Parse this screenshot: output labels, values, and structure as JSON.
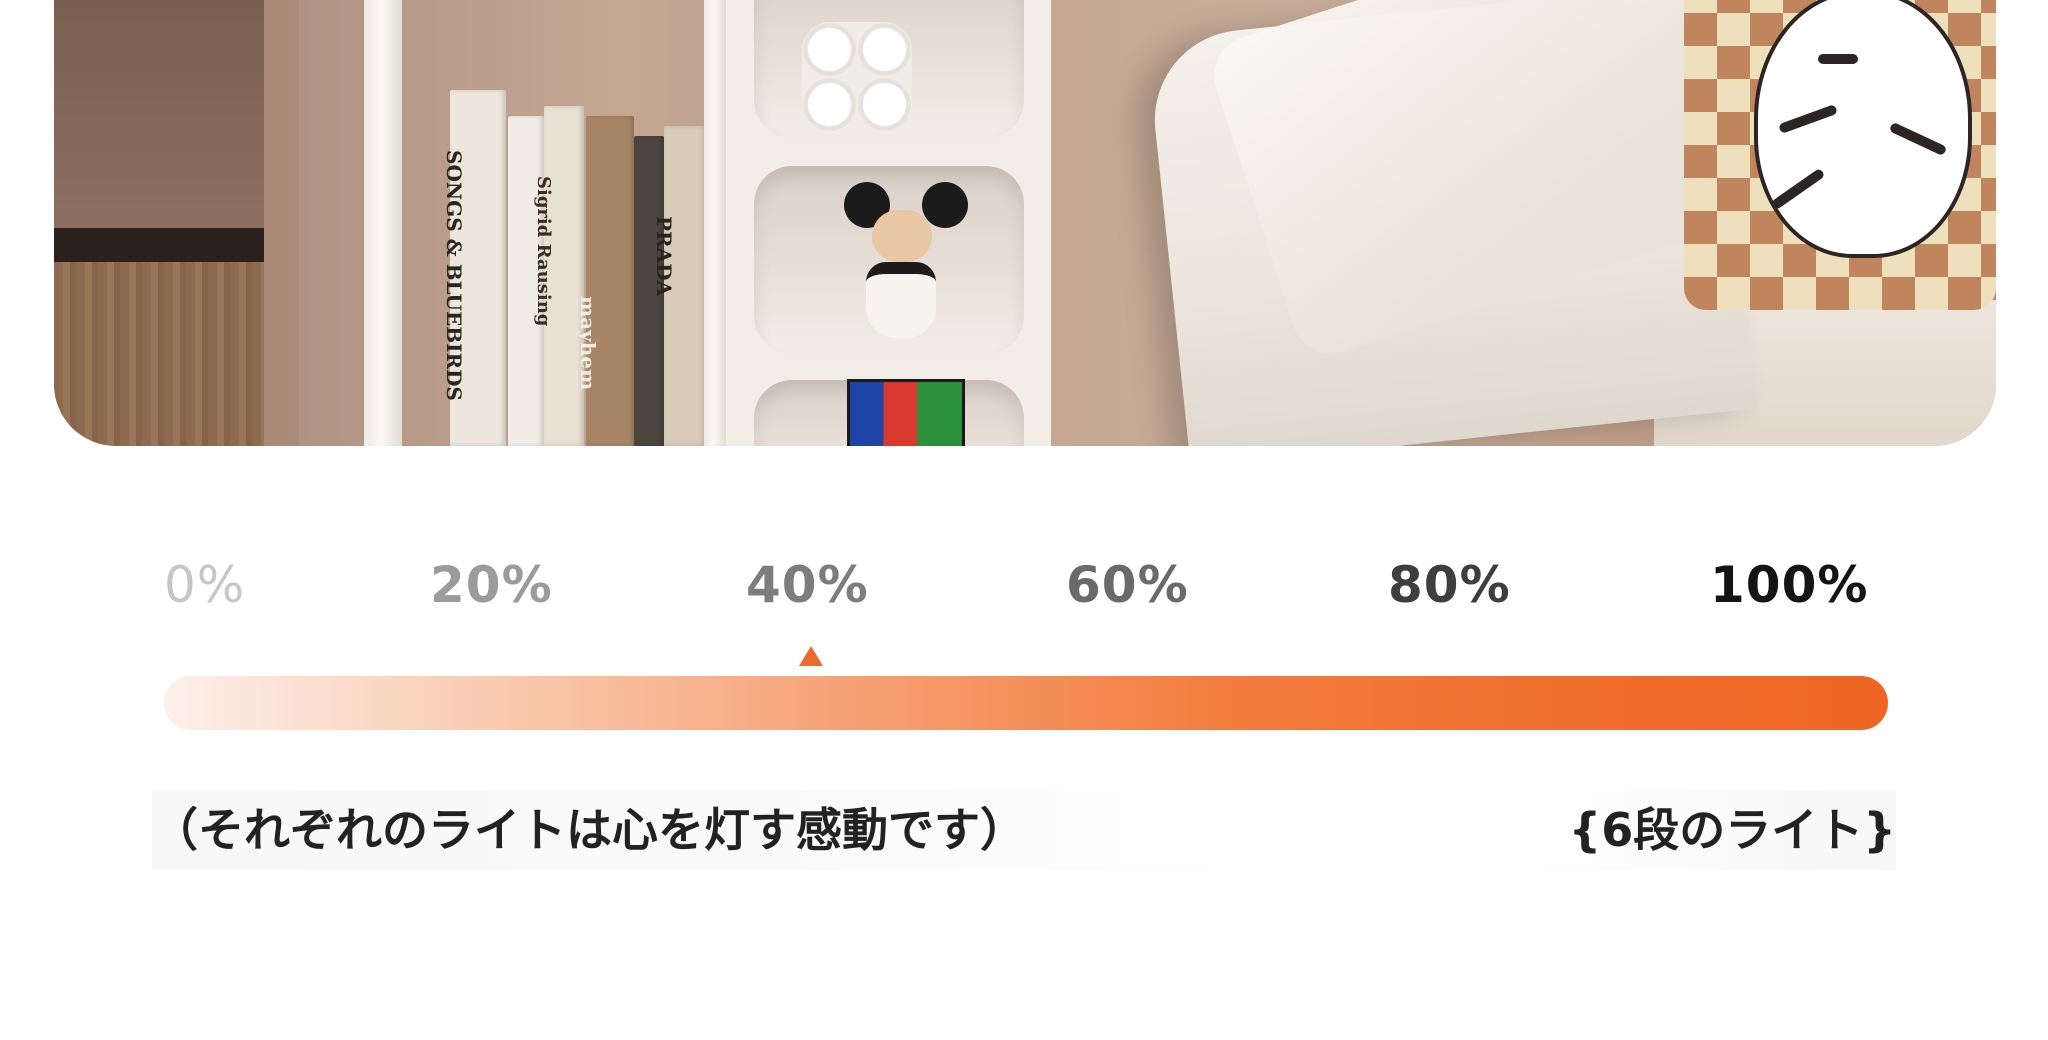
{
  "scale": {
    "ticks": [
      "0%",
      "20%",
      "40%",
      "60%",
      "80%",
      "100%"
    ],
    "indicator_level_percent": 40,
    "bar_colors": {
      "start": "#fdf0ea",
      "end": "#ee6523"
    },
    "marker_color": "#ee6a2c"
  },
  "captions": {
    "left": "（それぞれのライトは心を灯す感動です）",
    "right": "{6段のライト}"
  },
  "photo_text": {
    "book_1": "SONGS & BLUEBIRDS",
    "book_2": "Sigrid Rausing",
    "book_3": "mayhem",
    "book_4": "PRADA"
  }
}
